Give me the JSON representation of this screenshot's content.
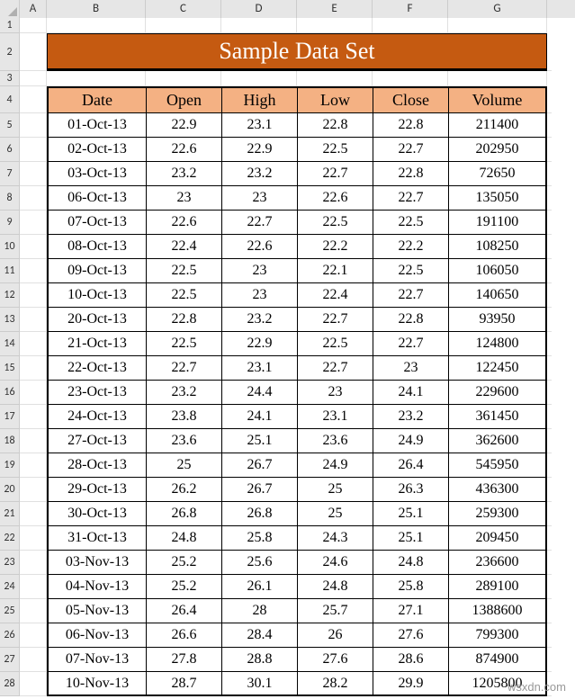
{
  "columns": [
    "",
    "A",
    "B",
    "C",
    "D",
    "E",
    "F",
    "G"
  ],
  "row_numbers": [
    "1",
    "2",
    "3",
    "4",
    "5",
    "6",
    "7",
    "8",
    "9",
    "10",
    "11",
    "12",
    "13",
    "14",
    "15",
    "16",
    "17",
    "18",
    "19",
    "20",
    "21",
    "22",
    "23",
    "24",
    "25",
    "26",
    "27",
    "28"
  ],
  "title": "Sample Data Set",
  "headers": [
    "Date",
    "Open",
    "High",
    "Low",
    "Close",
    "Volume"
  ],
  "chart_data": {
    "type": "table",
    "columns": [
      "Date",
      "Open",
      "High",
      "Low",
      "Close",
      "Volume"
    ],
    "rows": [
      [
        "01-Oct-13",
        "22.9",
        "23.1",
        "22.8",
        "22.8",
        "211400"
      ],
      [
        "02-Oct-13",
        "22.6",
        "22.9",
        "22.5",
        "22.7",
        "202950"
      ],
      [
        "03-Oct-13",
        "23.2",
        "23.2",
        "22.7",
        "22.8",
        "72650"
      ],
      [
        "06-Oct-13",
        "23",
        "23",
        "22.6",
        "22.7",
        "135050"
      ],
      [
        "07-Oct-13",
        "22.6",
        "22.7",
        "22.5",
        "22.5",
        "191100"
      ],
      [
        "08-Oct-13",
        "22.4",
        "22.6",
        "22.2",
        "22.2",
        "108250"
      ],
      [
        "09-Oct-13",
        "22.5",
        "23",
        "22.1",
        "22.5",
        "106050"
      ],
      [
        "10-Oct-13",
        "22.5",
        "23",
        "22.4",
        "22.7",
        "140650"
      ],
      [
        "20-Oct-13",
        "22.8",
        "23.2",
        "22.7",
        "22.8",
        "93950"
      ],
      [
        "21-Oct-13",
        "22.5",
        "22.9",
        "22.5",
        "22.7",
        "124800"
      ],
      [
        "22-Oct-13",
        "22.7",
        "23.1",
        "22.7",
        "23",
        "122450"
      ],
      [
        "23-Oct-13",
        "23.2",
        "24.4",
        "23",
        "24.1",
        "229600"
      ],
      [
        "24-Oct-13",
        "23.8",
        "24.1",
        "23.1",
        "23.2",
        "361450"
      ],
      [
        "27-Oct-13",
        "23.6",
        "25.1",
        "23.6",
        "24.9",
        "362600"
      ],
      [
        "28-Oct-13",
        "25",
        "26.7",
        "24.9",
        "26.4",
        "545950"
      ],
      [
        "29-Oct-13",
        "26.2",
        "26.7",
        "25",
        "26.3",
        "436300"
      ],
      [
        "30-Oct-13",
        "26.8",
        "26.8",
        "25",
        "25.1",
        "259300"
      ],
      [
        "31-Oct-13",
        "24.8",
        "25.8",
        "24.3",
        "25.1",
        "209450"
      ],
      [
        "03-Nov-13",
        "25.2",
        "25.6",
        "24.6",
        "24.8",
        "236600"
      ],
      [
        "04-Nov-13",
        "25.2",
        "26.1",
        "24.8",
        "25.8",
        "289100"
      ],
      [
        "05-Nov-13",
        "26.4",
        "28",
        "25.7",
        "27.1",
        "1388600"
      ],
      [
        "06-Nov-13",
        "26.6",
        "28.4",
        "26",
        "27.6",
        "799300"
      ],
      [
        "07-Nov-13",
        "27.8",
        "28.8",
        "27.6",
        "28.6",
        "874900"
      ],
      [
        "10-Nov-13",
        "28.7",
        "30.1",
        "28.2",
        "29.9",
        "1205800"
      ]
    ]
  },
  "watermark": "wsxdn.com"
}
